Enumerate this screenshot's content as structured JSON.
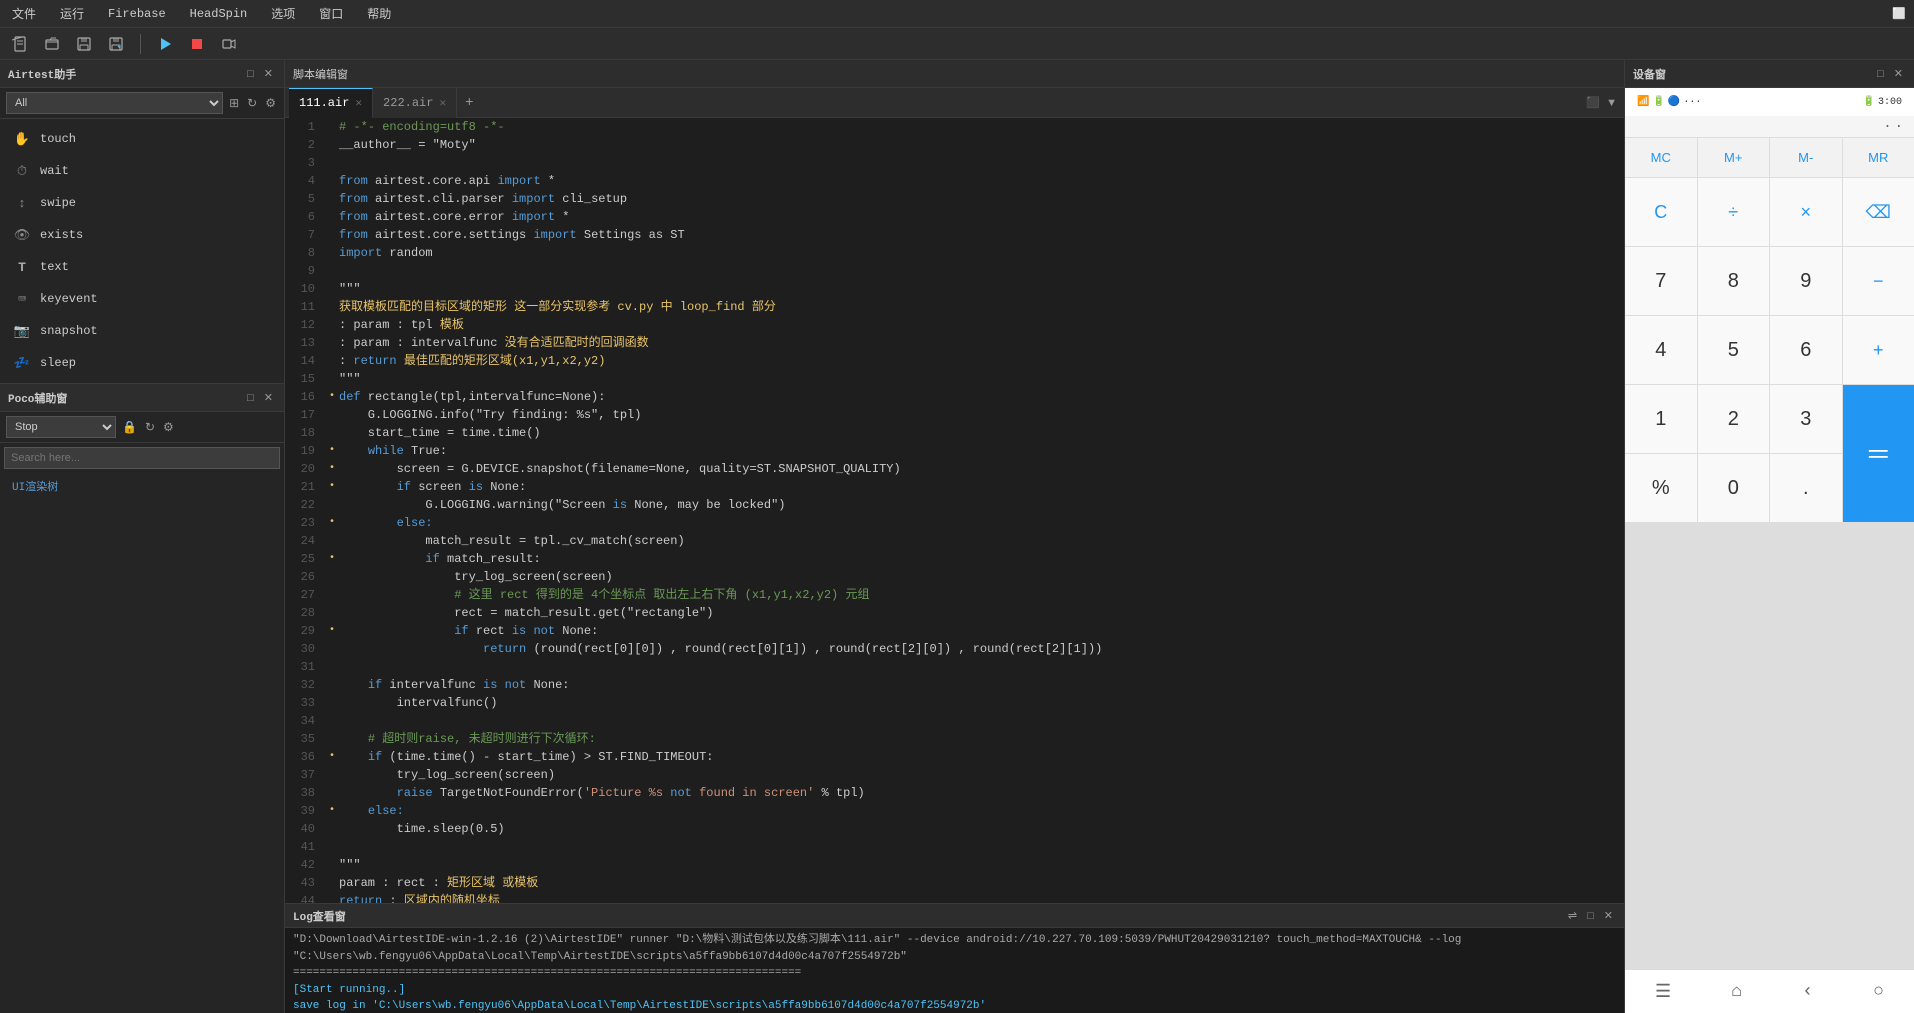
{
  "menubar": {
    "items": [
      "文件",
      "运行",
      "Firebase",
      "HeadSpin",
      "选项",
      "窗口",
      "帮助"
    ]
  },
  "toolbar": {
    "buttons": [
      "new",
      "open",
      "save",
      "save-as",
      "play",
      "stop",
      "record"
    ]
  },
  "left_panel": {
    "title": "Airtest助手",
    "dropdown_value": "All",
    "actions": [
      {
        "id": "touch",
        "label": "touch",
        "icon": "✋"
      },
      {
        "id": "wait",
        "label": "wait",
        "icon": "⏱"
      },
      {
        "id": "swipe",
        "label": "swipe",
        "icon": "↕"
      },
      {
        "id": "exists",
        "label": "exists",
        "icon": "👁"
      },
      {
        "id": "text",
        "label": "text",
        "icon": "T"
      },
      {
        "id": "keyevent",
        "label": "keyevent",
        "icon": "⌨"
      },
      {
        "id": "snapshot",
        "label": "snapshot",
        "icon": "📷"
      },
      {
        "id": "sleep",
        "label": "sleep",
        "icon": "💤"
      }
    ]
  },
  "poco_panel": {
    "title": "Poco辅助窗",
    "dropdown_value": "Stop",
    "search_placeholder": "Search here...",
    "tree_item": "UI渲染树"
  },
  "editor": {
    "title": "脚本编辑窗",
    "tabs": [
      {
        "label": "111.air",
        "active": true
      },
      {
        "label": "222.air",
        "active": false
      }
    ],
    "lines": [
      {
        "num": 1,
        "dot": false,
        "content": "# -*- encoding=utf8 -*-"
      },
      {
        "num": 2,
        "dot": false,
        "content": "__author__ = \"Moty\""
      },
      {
        "num": 3,
        "dot": false,
        "content": ""
      },
      {
        "num": 4,
        "dot": false,
        "content": "from airtest.core.api import *"
      },
      {
        "num": 5,
        "dot": false,
        "content": "from airtest.cli.parser import cli_setup"
      },
      {
        "num": 6,
        "dot": false,
        "content": "from airtest.core.error import *"
      },
      {
        "num": 7,
        "dot": false,
        "content": "from airtest.core.settings import Settings as ST"
      },
      {
        "num": 8,
        "dot": false,
        "content": "import random"
      },
      {
        "num": 9,
        "dot": false,
        "content": ""
      },
      {
        "num": 10,
        "dot": false,
        "content": "\"\"\""
      },
      {
        "num": 11,
        "dot": false,
        "content": "获取模板匹配的目标区域的矩形 这一部分实现参考 cv.py 中 loop_find 部分"
      },
      {
        "num": 12,
        "dot": false,
        "content": ": param : tpl 模板"
      },
      {
        "num": 13,
        "dot": false,
        "content": ": param : intervalfunc 没有合适匹配时的回调函数"
      },
      {
        "num": 14,
        "dot": false,
        "content": ": return 最佳匹配的矩形区域(x1,y1,x2,y2)"
      },
      {
        "num": 15,
        "dot": false,
        "content": "\"\"\""
      },
      {
        "num": 16,
        "dot": true,
        "content": "def rectangle(tpl,intervalfunc=None):"
      },
      {
        "num": 17,
        "dot": false,
        "content": "    G.LOGGING.info(\"Try finding: %s\", tpl)"
      },
      {
        "num": 18,
        "dot": false,
        "content": "    start_time = time.time()"
      },
      {
        "num": 19,
        "dot": true,
        "content": "    while True:"
      },
      {
        "num": 20,
        "dot": true,
        "content": "        screen = G.DEVICE.snapshot(filename=None, quality=ST.SNAPSHOT_QUALITY)"
      },
      {
        "num": 21,
        "dot": true,
        "content": "        if screen is None:"
      },
      {
        "num": 22,
        "dot": false,
        "content": "            G.LOGGING.warning(\"Screen is None, may be locked\")"
      },
      {
        "num": 23,
        "dot": true,
        "content": "        else:"
      },
      {
        "num": 24,
        "dot": false,
        "content": "            match_result = tpl._cv_match(screen)"
      },
      {
        "num": 25,
        "dot": true,
        "content": "            if match_result:"
      },
      {
        "num": 26,
        "dot": false,
        "content": "                try_log_screen(screen)"
      },
      {
        "num": 27,
        "dot": false,
        "content": "                # 这里 rect 得到的是 4个坐标点 取出左上右下角 (x1,y1,x2,y2) 元组"
      },
      {
        "num": 28,
        "dot": false,
        "content": "                rect = match_result.get(\"rectangle\")"
      },
      {
        "num": 29,
        "dot": true,
        "content": "                if rect is not None:"
      },
      {
        "num": 30,
        "dot": false,
        "content": "                    return (round(rect[0][0]) , round(rect[0][1]) , round(rect[2][0]) , round(rect[2][1]))"
      },
      {
        "num": 31,
        "dot": false,
        "content": ""
      },
      {
        "num": 32,
        "dot": false,
        "content": "    if intervalfunc is not None:"
      },
      {
        "num": 33,
        "dot": false,
        "content": "        intervalfunc()"
      },
      {
        "num": 34,
        "dot": false,
        "content": ""
      },
      {
        "num": 35,
        "dot": false,
        "content": "    # 超时则raise, 未超时则进行下次循环:"
      },
      {
        "num": 36,
        "dot": true,
        "content": "    if (time.time() - start_time) > ST.FIND_TIMEOUT:"
      },
      {
        "num": 37,
        "dot": false,
        "content": "        try_log_screen(screen)"
      },
      {
        "num": 38,
        "dot": false,
        "content": "        raise TargetNotFoundError('Picture %s not found in screen' % tpl)"
      },
      {
        "num": 39,
        "dot": true,
        "content": "    else:"
      },
      {
        "num": 40,
        "dot": false,
        "content": "        time.sleep(0.5)"
      },
      {
        "num": 41,
        "dot": false,
        "content": ""
      },
      {
        "num": 42,
        "dot": false,
        "content": "\"\"\""
      },
      {
        "num": 43,
        "dot": false,
        "content": "param : rect : 矩形区域 或模板"
      },
      {
        "num": 44,
        "dot": false,
        "content": "return : 区域内的随机坐标"
      }
    ]
  },
  "log_panel": {
    "title": "Log查看窗",
    "lines": [
      "\"D:\\Download\\AirtestIDE-win-1.2.16 (2)\\AirtestIDE\" runner \"D:\\物料\\测试包体以及练习脚本\\111.air\"  --device android://10.227.70.109:5039/PWHUT20429031210? touch_method=MAXTOUCH& --log \"C:\\Users\\wb.fengyu06\\AppData\\Local\\Temp\\AirtestIDE\\scripts\\a5ffa9bb6107d4d00c4a707f2554972b\"",
      "=============================================================================",
      "",
      "[Start running..]",
      "save log in 'C:\\Users\\wb.fengyu06\\AppData\\Local\\Temp\\AirtestIDE\\scripts\\a5ffa9bb6107d4d00c4a707f2554972b'"
    ]
  },
  "right_panel": {
    "title": "设备窗",
    "status_bar": {
      "left": "📶 🔋 3:00",
      "right": "3:00"
    },
    "calculator": {
      "memory_buttons": [
        "MC",
        "M+",
        "M-",
        "MR"
      ],
      "rows": [
        [
          "C",
          "÷",
          "×",
          "⌫"
        ],
        [
          "7",
          "8",
          "9",
          "−"
        ],
        [
          "4",
          "5",
          "6",
          "+"
        ],
        [
          "1",
          "2",
          "3",
          "="
        ],
        [
          "%",
          "0",
          ".",
          "="
        ]
      ]
    },
    "nav_icons": [
      "☰",
      "⌂",
      "‹",
      "○"
    ]
  }
}
